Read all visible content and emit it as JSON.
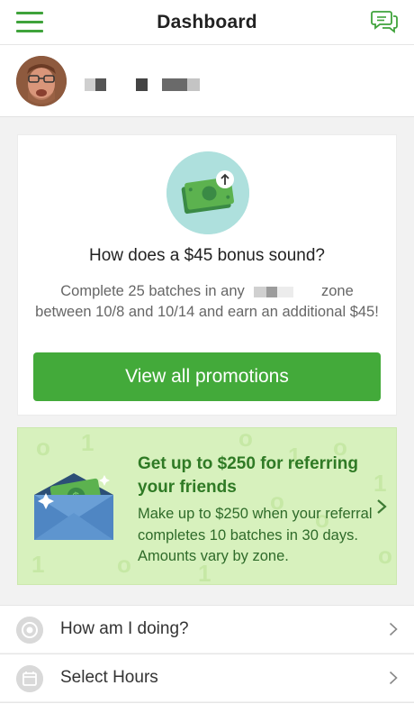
{
  "header": {
    "title": "Dashboard",
    "menu_icon": "hamburger-menu-icon",
    "chat_icon": "chat-bubbles-icon",
    "accent_color": "#3fa33b"
  },
  "profile": {
    "avatar_icon": "user-avatar"
  },
  "promotion": {
    "icon": "money-upload-icon",
    "heading": "How does a $45 bonus sound?",
    "body_part1": "Complete 25 batches in any",
    "body_part2": "zone between 10/8 and 10/14 and earn an additional $45!",
    "button_label": "View all promotions",
    "button_color": "#43aa3a"
  },
  "referral": {
    "icon": "money-envelope-icon",
    "heading": "Get up to $250 for referring your friends",
    "body": "Make up to $250 when your referral completes 10 batches in 30 days. Amounts vary by zone.",
    "background_color": "#d7f1bd"
  },
  "menu_list": [
    {
      "label": "How am I doing?",
      "icon": "target-icon"
    },
    {
      "label": "Select Hours",
      "icon": "calendar-icon"
    }
  ]
}
